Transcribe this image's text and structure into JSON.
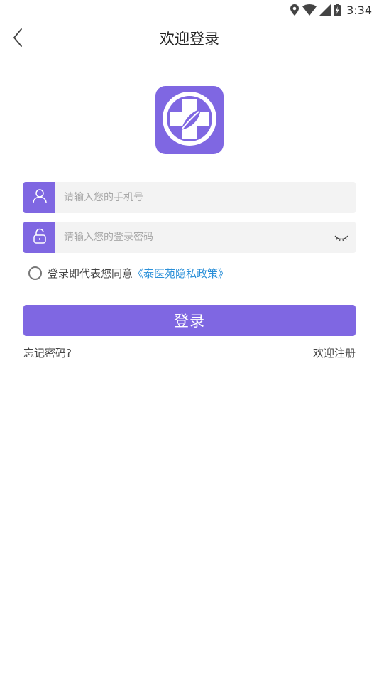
{
  "status_bar": {
    "time": "3:34",
    "icons": [
      "location-icon",
      "wifi-icon",
      "signal-icon",
      "battery-icon"
    ]
  },
  "header": {
    "title": "欢迎登录",
    "back_icon": "chevron-left-icon"
  },
  "logo": {
    "icon": "medical-cross-leaf-icon",
    "brand_color": "#7f67e2"
  },
  "form": {
    "phone": {
      "placeholder": "请输入您的手机号",
      "value": "",
      "icon": "user-icon"
    },
    "password": {
      "placeholder": "请输入您的登录密码",
      "value": "",
      "icon": "lock-icon",
      "toggle_icon": "eye-closed-icon"
    }
  },
  "agreement": {
    "prefix": "登录即代表您同意",
    "link_text": "《泰医苑隐私政策》",
    "checked": false
  },
  "login_button": {
    "label": "登录"
  },
  "links": {
    "forgot": "忘记密码?",
    "register": "欢迎注册"
  },
  "colors": {
    "accent": "#7f67e2",
    "link": "#2a8fd8",
    "input_bg": "#f3f3f3"
  }
}
